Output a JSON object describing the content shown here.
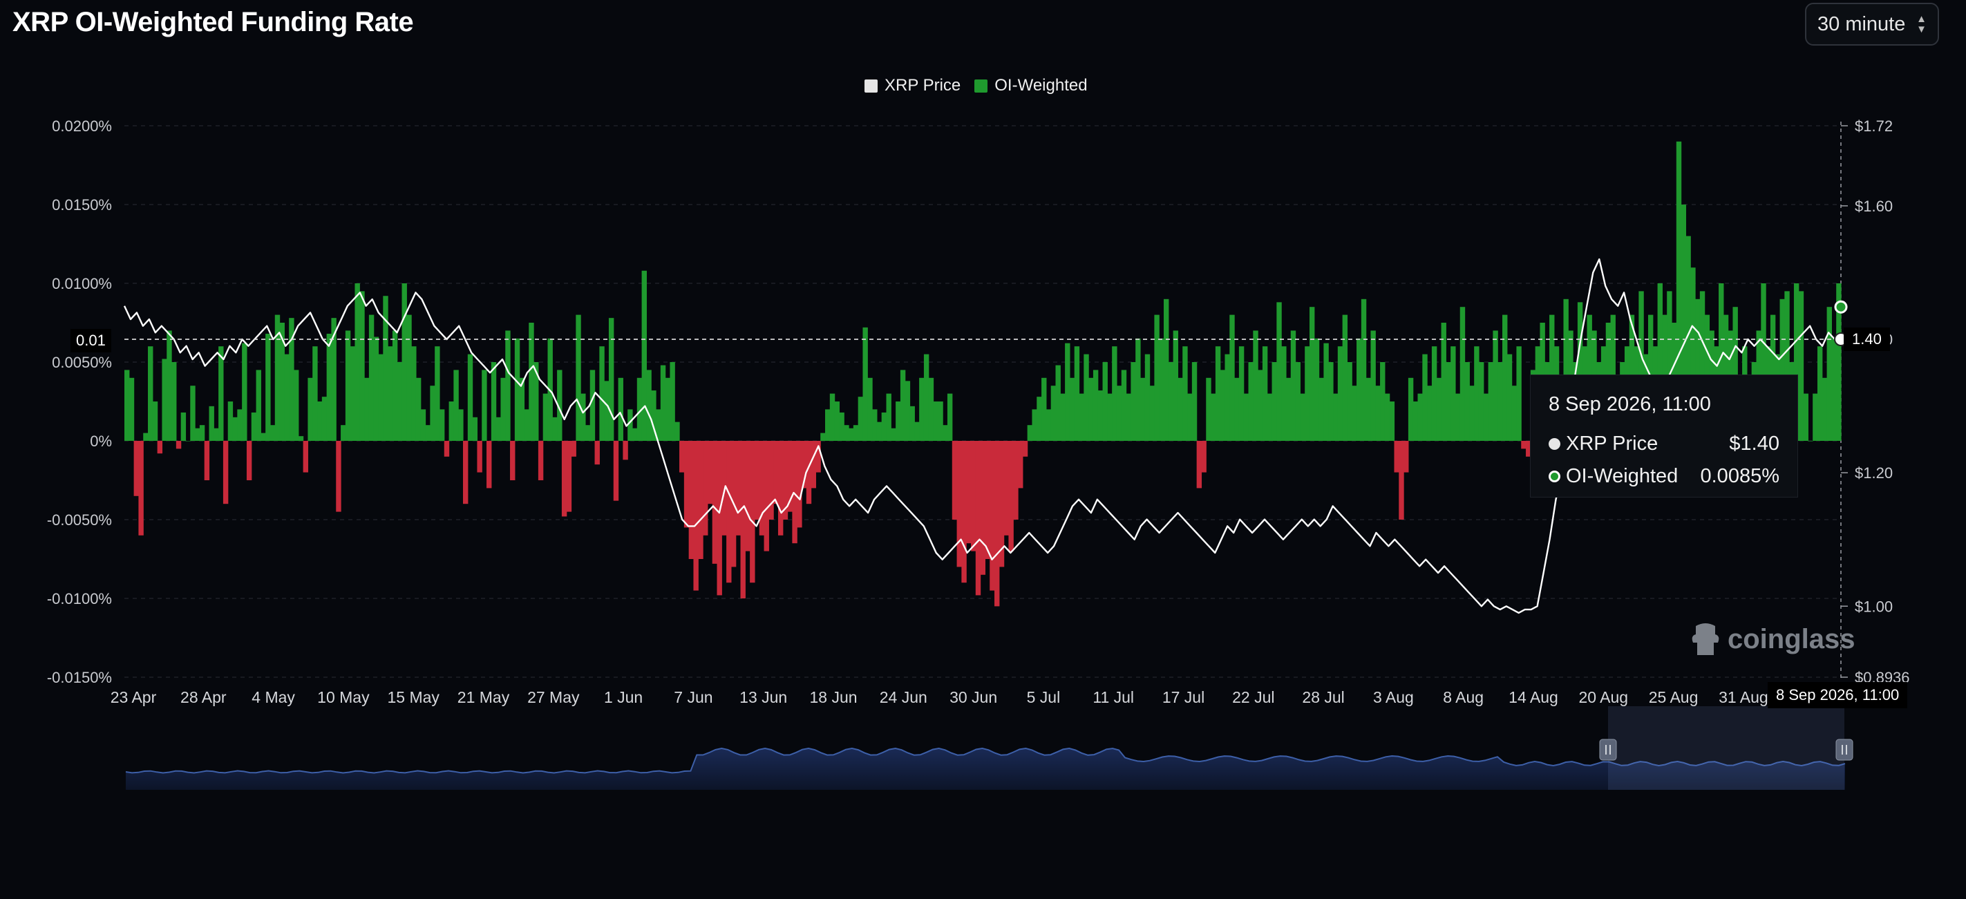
{
  "header": {
    "title": "XRP OI-Weighted Funding Rate",
    "interval_select": {
      "value": "30 minute"
    }
  },
  "legend": [
    {
      "label": "XRP Price",
      "color": "#e6e6e6"
    },
    {
      "label": "OI-Weighted",
      "color": "#1f9a2e"
    }
  ],
  "tooltip": {
    "title": "8 Sep 2026, 11:00",
    "rows": [
      {
        "label": "XRP Price",
        "value": "$1.40"
      },
      {
        "label": "OI-Weighted",
        "value": "0.0085%"
      }
    ]
  },
  "crosshair": {
    "x_label": "8 Sep 2026, 11:00",
    "left_value": "0.01",
    "right_value": "1.40"
  },
  "brand": {
    "name": "coinglass",
    "icon": "coinglass-logo-icon"
  },
  "colors": {
    "positive": "#1f9a2e",
    "negative": "#c92a3a",
    "price_line": "#ffffff",
    "navigator_line": "#3d5fa8",
    "navigator_fill": "#0f1a33"
  },
  "chart_data": {
    "type": "area",
    "title": "XRP OI-Weighted Funding Rate",
    "x_ticks": [
      "23 Apr",
      "28 Apr",
      "4 May",
      "10 May",
      "15 May",
      "21 May",
      "27 May",
      "1 Jun",
      "7 Jun",
      "13 Jun",
      "18 Jun",
      "24 Jun",
      "30 Jun",
      "5 Jul",
      "11 Jul",
      "17 Jul",
      "22 Jul",
      "28 Jul",
      "3 Aug",
      "8 Aug",
      "14 Aug",
      "20 Aug",
      "25 Aug",
      "31 Aug"
    ],
    "y_left_ticks": [
      "0.0200%",
      "0.0150%",
      "0.0100%",
      "0.0050%",
      "0%",
      "-0.0050%",
      "-0.0100%",
      "-0.0150%"
    ],
    "y_right_ticks": [
      "$1.72",
      "$1.60",
      "$1.40",
      "$1.20",
      "$1.00",
      "$0.8936"
    ],
    "ylim_left": [
      -0.015,
      0.02
    ],
    "ylim_right": [
      0.8936,
      1.72
    ],
    "grid": true,
    "legend_position": "top-center",
    "series": [
      {
        "name": "OI-Weighted",
        "axis": "left",
        "values": [
          0.0045,
          0.004,
          -0.0035,
          -0.006,
          0.0005,
          0.006,
          0.0025,
          -0.0008,
          0.0052,
          0.007,
          0.005,
          -0.0005,
          0.0018,
          0.0,
          0.0035,
          0.0008,
          0.001,
          -0.0025,
          0.0022,
          0.0008,
          0.006,
          -0.004,
          0.0025,
          0.0015,
          0.002,
          0.0062,
          -0.0025,
          0.0018,
          0.0045,
          0.0005,
          0.0068,
          0.001,
          0.008,
          0.0075,
          0.0055,
          0.0078,
          0.0045,
          0.0003,
          -0.002,
          0.004,
          0.006,
          0.0025,
          0.0028,
          0.0068,
          0.0078,
          -0.0045,
          0.001,
          0.007,
          0.006,
          0.01,
          0.0095,
          0.004,
          0.008,
          0.0066,
          0.0055,
          0.0092,
          0.006,
          0.007,
          0.005,
          0.01,
          0.008,
          0.006,
          0.004,
          0.002,
          0.001,
          0.0035,
          0.006,
          0.002,
          -0.001,
          0.0025,
          0.0045,
          0.002,
          -0.004,
          0.0055,
          0.0015,
          -0.002,
          0.0045,
          -0.003,
          0.005,
          0.0015,
          0.004,
          0.007,
          -0.0025,
          0.0065,
          0.004,
          0.002,
          0.0075,
          0.005,
          -0.0025,
          0.003,
          0.0065,
          0.0015,
          0.0045,
          -0.0048,
          -0.0045,
          -0.001,
          0.008,
          0.003,
          0.001,
          0.0045,
          -0.0015,
          0.006,
          0.0038,
          0.0078,
          -0.0038,
          0.004,
          -0.0012,
          0.002,
          0.0008,
          0.004,
          0.0108,
          0.0045,
          0.0032,
          0.002,
          0.0048,
          0.004,
          0.005,
          0.0012,
          -0.002,
          -0.0055,
          -0.0075,
          -0.0095,
          -0.0075,
          -0.006,
          -0.004,
          -0.0078,
          -0.0098,
          -0.006,
          -0.009,
          -0.008,
          -0.006,
          -0.01,
          -0.007,
          -0.009,
          -0.005,
          -0.006,
          -0.007,
          -0.005,
          -0.004,
          -0.006,
          -0.005,
          -0.0045,
          -0.0065,
          -0.0055,
          -0.003,
          -0.004,
          -0.003,
          -0.002,
          0.0005,
          0.002,
          0.003,
          0.0025,
          0.0018,
          0.001,
          0.0008,
          0.001,
          0.0028,
          0.0072,
          0.004,
          0.002,
          0.0012,
          0.0018,
          0.003,
          0.0008,
          0.0025,
          0.0045,
          0.0038,
          0.0022,
          0.0012,
          0.004,
          0.0055,
          0.004,
          0.0025,
          0.0025,
          0.001,
          0.003,
          -0.005,
          -0.008,
          -0.009,
          -0.0065,
          -0.007,
          -0.0098,
          -0.0085,
          -0.0075,
          -0.0095,
          -0.0105,
          -0.008,
          -0.006,
          -0.007,
          -0.005,
          -0.003,
          -0.001,
          0.001,
          0.002,
          0.0028,
          0.004,
          0.002,
          0.0035,
          0.0048,
          0.003,
          0.0062,
          0.004,
          0.006,
          0.003,
          0.0055,
          0.004,
          0.0045,
          0.0032,
          0.005,
          0.003,
          0.006,
          0.0035,
          0.0045,
          0.003,
          0.005,
          0.0065,
          0.004,
          0.0055,
          0.0035,
          0.008,
          0.0065,
          0.009,
          0.005,
          0.007,
          0.004,
          0.006,
          0.003,
          0.005,
          -0.003,
          -0.002,
          0.004,
          0.003,
          0.006,
          0.0045,
          0.0055,
          0.008,
          0.004,
          0.006,
          0.003,
          0.005,
          0.007,
          0.0045,
          0.006,
          0.003,
          0.005,
          0.0088,
          0.006,
          0.004,
          0.007,
          0.005,
          0.003,
          0.006,
          0.0085,
          0.0065,
          0.004,
          0.0062,
          0.005,
          0.003,
          0.006,
          0.008,
          0.005,
          0.0035,
          0.0065,
          0.009,
          0.004,
          0.007,
          0.0035,
          0.005,
          0.003,
          0.0025,
          -0.002,
          -0.005,
          -0.002,
          0.004,
          0.0025,
          0.003,
          0.0055,
          0.0035,
          0.006,
          0.004,
          0.0075,
          0.005,
          0.006,
          0.003,
          0.0085,
          0.005,
          0.0035,
          0.006,
          0.005,
          0.003,
          0.005,
          0.007,
          0.005,
          0.008,
          0.0055,
          0.0035,
          0.006,
          -0.0005,
          -0.001,
          0.0045,
          0.006,
          0.0075,
          0.005,
          0.008,
          0.006,
          0.004,
          0.009,
          0.007,
          0.005,
          0.0088,
          0.006,
          0.008,
          0.007,
          0.005,
          0.006,
          0.0075,
          0.008,
          0.003,
          0.005,
          0.006,
          0.008,
          0.006,
          0.0095,
          0.0055,
          0.008,
          0.006,
          0.01,
          0.008,
          0.0095,
          0.0075,
          0.019,
          0.015,
          0.013,
          0.011,
          0.009,
          0.0095,
          0.008,
          0.007,
          0.006,
          0.01,
          0.008,
          0.007,
          0.0085,
          0.004,
          0.006,
          0.003,
          0.005,
          0.007,
          0.01,
          0.006,
          0.008,
          0.0055,
          0.009,
          0.0095,
          0.005,
          0.01,
          0.0095,
          0.003,
          0.0,
          0.003,
          0.006,
          0.004,
          0.0085,
          0.0065,
          0.01
        ]
      },
      {
        "name": "XRP Price",
        "axis": "right",
        "values": [
          1.45,
          1.43,
          1.44,
          1.42,
          1.43,
          1.41,
          1.42,
          1.41,
          1.4,
          1.38,
          1.39,
          1.37,
          1.38,
          1.36,
          1.37,
          1.38,
          1.37,
          1.39,
          1.38,
          1.4,
          1.39,
          1.4,
          1.41,
          1.42,
          1.4,
          1.41,
          1.39,
          1.4,
          1.42,
          1.43,
          1.44,
          1.42,
          1.4,
          1.39,
          1.41,
          1.43,
          1.45,
          1.46,
          1.47,
          1.45,
          1.46,
          1.44,
          1.43,
          1.42,
          1.41,
          1.43,
          1.45,
          1.47,
          1.46,
          1.44,
          1.42,
          1.41,
          1.4,
          1.41,
          1.42,
          1.4,
          1.38,
          1.37,
          1.36,
          1.35,
          1.36,
          1.37,
          1.35,
          1.34,
          1.33,
          1.35,
          1.36,
          1.34,
          1.33,
          1.32,
          1.3,
          1.28,
          1.3,
          1.31,
          1.29,
          1.3,
          1.32,
          1.31,
          1.3,
          1.28,
          1.29,
          1.27,
          1.28,
          1.29,
          1.3,
          1.28,
          1.25,
          1.22,
          1.19,
          1.16,
          1.13,
          1.12,
          1.12,
          1.13,
          1.14,
          1.15,
          1.14,
          1.18,
          1.16,
          1.14,
          1.15,
          1.13,
          1.12,
          1.14,
          1.15,
          1.16,
          1.14,
          1.15,
          1.17,
          1.16,
          1.2,
          1.22,
          1.24,
          1.21,
          1.19,
          1.18,
          1.16,
          1.15,
          1.16,
          1.15,
          1.14,
          1.16,
          1.17,
          1.18,
          1.17,
          1.16,
          1.15,
          1.14,
          1.13,
          1.12,
          1.1,
          1.08,
          1.07,
          1.08,
          1.09,
          1.1,
          1.08,
          1.09,
          1.1,
          1.09,
          1.07,
          1.08,
          1.09,
          1.08,
          1.09,
          1.1,
          1.11,
          1.1,
          1.09,
          1.08,
          1.09,
          1.11,
          1.13,
          1.15,
          1.16,
          1.15,
          1.14,
          1.16,
          1.15,
          1.14,
          1.13,
          1.12,
          1.11,
          1.1,
          1.12,
          1.13,
          1.12,
          1.11,
          1.12,
          1.13,
          1.14,
          1.13,
          1.12,
          1.11,
          1.1,
          1.09,
          1.08,
          1.1,
          1.12,
          1.11,
          1.13,
          1.12,
          1.11,
          1.12,
          1.13,
          1.12,
          1.11,
          1.1,
          1.11,
          1.12,
          1.13,
          1.12,
          1.13,
          1.12,
          1.13,
          1.15,
          1.14,
          1.13,
          1.12,
          1.11,
          1.1,
          1.09,
          1.11,
          1.1,
          1.09,
          1.1,
          1.09,
          1.08,
          1.07,
          1.06,
          1.07,
          1.06,
          1.05,
          1.06,
          1.05,
          1.04,
          1.03,
          1.02,
          1.01,
          1.0,
          1.01,
          1.0,
          0.995,
          1.0,
          0.995,
          0.99,
          0.995,
          0.995,
          1.0,
          1.05,
          1.1,
          1.16,
          1.2,
          1.28,
          1.34,
          1.4,
          1.45,
          1.5,
          1.52,
          1.48,
          1.46,
          1.45,
          1.47,
          1.43,
          1.4,
          1.37,
          1.35,
          1.33,
          1.3,
          1.34,
          1.36,
          1.38,
          1.4,
          1.42,
          1.41,
          1.39,
          1.37,
          1.36,
          1.38,
          1.37,
          1.39,
          1.38,
          1.4,
          1.39,
          1.4,
          1.39,
          1.38,
          1.37,
          1.38,
          1.39,
          1.4,
          1.41,
          1.42,
          1.4,
          1.39,
          1.41,
          1.4,
          1.4
        ]
      }
    ]
  }
}
